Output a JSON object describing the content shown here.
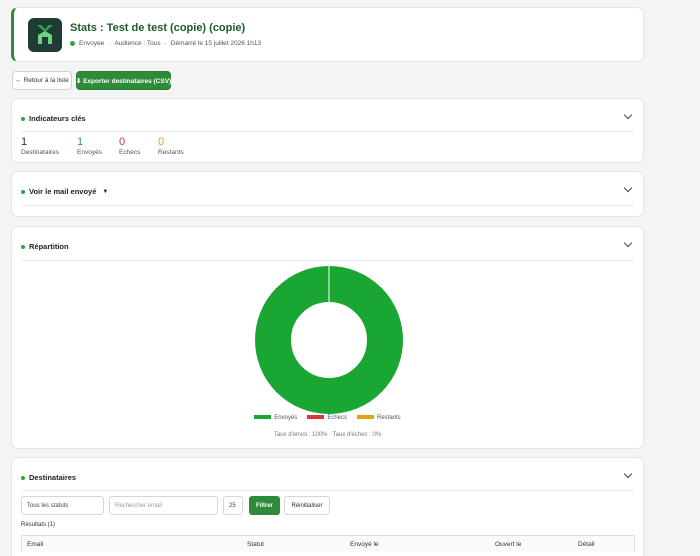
{
  "header": {
    "title": "Stats : Test de test (copie) (copie)",
    "status": "Envoyee",
    "audience": "Audience : Tous",
    "started": "Démarré le 15 juillet 2026 1h13",
    "separator": "·"
  },
  "toolbar": {
    "back_label": "← Retour à la liste",
    "export_label": "⬇ Exporter destinataires (CSV)"
  },
  "indicators": {
    "title": "Indicateurs clés",
    "items": [
      {
        "value": "1",
        "label": "Destinataires",
        "color": "#333333"
      },
      {
        "value": "1",
        "label": "Envoyés",
        "color": "#2fa544"
      },
      {
        "value": "0",
        "label": "Echecs",
        "color": "#d9363e"
      },
      {
        "value": "0",
        "label": "Restants",
        "color": "#e0a21a"
      }
    ]
  },
  "mail": {
    "title": "Voir le mail envoyé",
    "caret": "▼"
  },
  "repartition": {
    "title": "Répartition",
    "rate_text": "Taux d'envoi : 100% · Taux d'échec : 0%"
  },
  "chart_data": {
    "type": "pie",
    "labels": [
      "Envoyés",
      "Echecs",
      "Restants"
    ],
    "values": [
      1,
      0,
      0
    ],
    "colors": [
      "#1aa632",
      "#d9363e",
      "#e0a21a"
    ],
    "legend": "bottom",
    "donut": true
  },
  "recipients": {
    "title": "Destinataires",
    "status_filter": "Tous les statuts",
    "search_placeholder": "Rechercher email",
    "page_size": "25",
    "filter_label": "Filtrer",
    "reset_label": "Réinitialiser",
    "results": "Résultats (1)",
    "columns": [
      "Email",
      "Statut",
      "Envoyé le",
      "Ouvert le",
      "Détail"
    ]
  }
}
